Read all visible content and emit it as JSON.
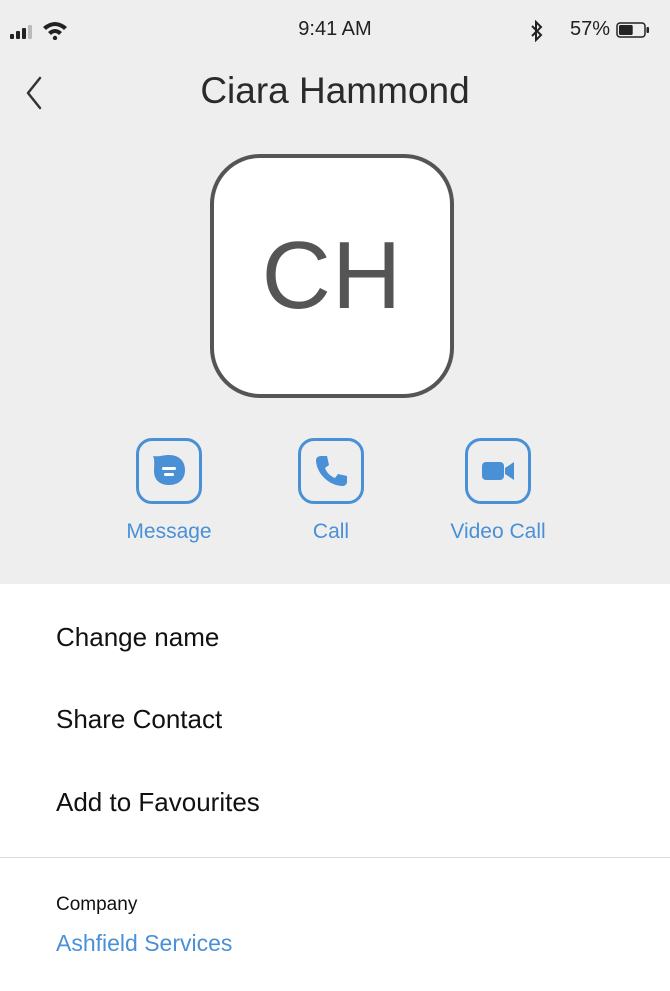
{
  "status_bar": {
    "time": "9:41 AM",
    "battery_percent": "57%",
    "battery_level": 0.57
  },
  "header": {
    "title": "Ciara Hammond"
  },
  "avatar": {
    "initials": "CH"
  },
  "actions": [
    {
      "label": "Message",
      "icon": "message-icon"
    },
    {
      "label": "Call",
      "icon": "phone-icon"
    },
    {
      "label": "Video Call",
      "icon": "video-camera-icon"
    }
  ],
  "menu": {
    "items": [
      "Change name",
      "Share Contact",
      "Add to Favourites"
    ]
  },
  "details": {
    "company_label": "Company",
    "company_value": "Ashfield Services"
  },
  "colors": {
    "accent": "#4a90d6",
    "header_bg": "#eeeeee"
  }
}
